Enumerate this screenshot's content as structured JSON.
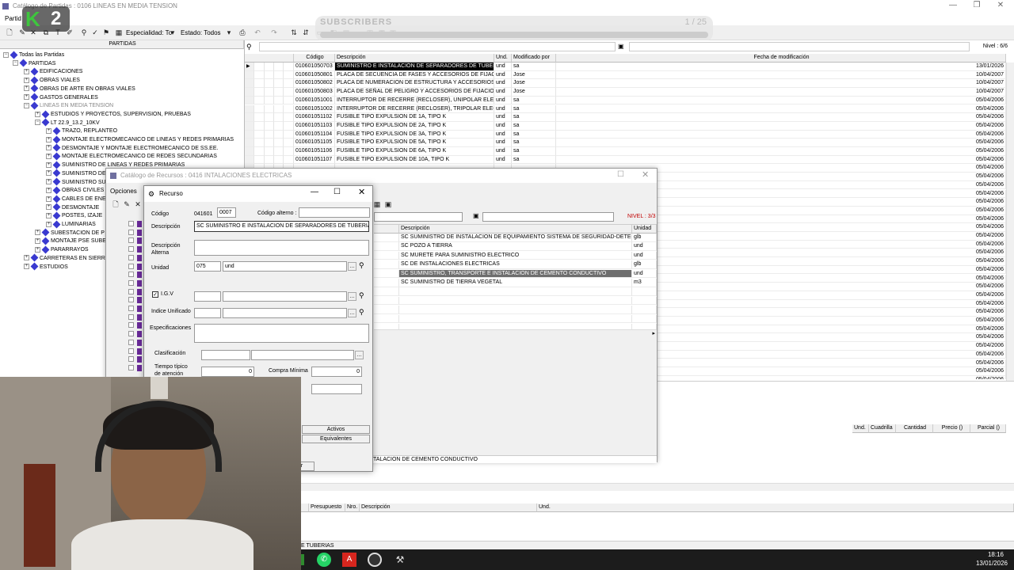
{
  "main_window": {
    "title": "Catálogo de Partidas : 0106  LINEAS EN MEDIA TENSION",
    "menu_partida": "Partid",
    "especialidad_label": "Especialidad: To",
    "estado_label": "Estado: Todos",
    "left_header": "PARTIDAS",
    "nivel": "Nivel : 6/6"
  },
  "overlay": {
    "channel_badge": "2",
    "subscribers_label": "SUBSCRIBERS",
    "counter": "1 / 25"
  },
  "grid": {
    "headers": [
      "Código",
      "Descripción",
      "Und.",
      "Modificado por",
      "Fecha de modificación"
    ],
    "rows": [
      [
        "010601050703",
        "SUMINISTRO E INSTALACIÓN DE SEPARADORES DE TUBERI",
        "und",
        "sa",
        "13/01/2026"
      ],
      [
        "010601050801",
        "PLACA DE SECUENCIA DE FASES Y ACCESORIOS DE FIJACIO",
        "und",
        "Jose",
        "10/04/2007"
      ],
      [
        "010601050802",
        "PLACA DE NUMERACION DE ESTRUCTURA Y ACCESORIOS D",
        "und",
        "Jose",
        "10/04/2007"
      ],
      [
        "010601050803",
        "PLACA DE SEÑAL DE PELIGRO Y ACCESORIOS DE FIJACION",
        "und",
        "Jose",
        "10/04/2007"
      ],
      [
        "010601051001",
        "INTERRUPTOR DE RECERRE (RECLOSER), UNIPOLAR ELECTR",
        "und",
        "sa",
        "05/04/2006"
      ],
      [
        "010601051002",
        "INTERRUPTOR DE RECERRE (RECLOSER), TRIPOLAR ELECTR",
        "und",
        "sa",
        "05/04/2006"
      ],
      [
        "010601051102",
        "FUSIBLE TIPO EXPULSION DE 1A, TIPO K",
        "und",
        "sa",
        "05/04/2006"
      ],
      [
        "010601051103",
        "FUSIBLE TIPO EXPULSION DE 2A, TIPO K",
        "und",
        "sa",
        "05/04/2006"
      ],
      [
        "010601051104",
        "FUSIBLE TIPO EXPULSION DE 3A, TIPO K",
        "und",
        "sa",
        "05/04/2006"
      ],
      [
        "010601051105",
        "FUSIBLE TIPO EXPULSION DE 5A, TIPO K",
        "und",
        "sa",
        "05/04/2006"
      ],
      [
        "010601051106",
        "FUSIBLE TIPO EXPULSION DE 6A, TIPO K",
        "und",
        "sa",
        "05/04/2006"
      ],
      [
        "010601051107",
        "FUSIBLE TIPO EXPULSION DE 10A, TIPO K",
        "und",
        "sa",
        "05/04/2006"
      ]
    ],
    "extra_dates": [
      "05/04/2006",
      "05/04/2006",
      "05/04/2006",
      "05/04/2006",
      "05/04/2006",
      "05/04/2006",
      "05/04/2006",
      "05/04/2006",
      "05/04/2006",
      "05/04/2006",
      "05/04/2006",
      "05/04/2006",
      "05/04/2006",
      "05/04/2006",
      "05/04/2006",
      "05/04/2006",
      "05/04/2006",
      "05/04/2006",
      "05/04/2006",
      "05/04/2006",
      "05/04/2006",
      "05/04/2006",
      "05/04/2006",
      "05/04/2006",
      "05/04/2006",
      "05/04/2006"
    ]
  },
  "tree": {
    "items": [
      {
        "label": "Todas las Partidas",
        "level": 0
      },
      {
        "label": "PARTIDAS",
        "level": 1
      },
      {
        "label": "EDIFICACIONES",
        "level": 2
      },
      {
        "label": "OBRAS VIALES",
        "level": 2
      },
      {
        "label": "OBRAS DE ARTE EN OBRAS VIALES",
        "level": 2
      },
      {
        "label": "GASTOS GENERALES",
        "level": 2
      },
      {
        "label": "LINEAS EN MEDIA TENSION",
        "level": 2
      },
      {
        "label": "ESTUDIOS Y PROYECTOS, SUPERVISION, PRUEBAS",
        "level": 3
      },
      {
        "label": "LT 22.9_13.2_10KV",
        "level": 3
      },
      {
        "label": "TRAZO, REPLANTEO",
        "level": 4
      },
      {
        "label": "MONTAJE ELECTROMECANICO DE LINEAS Y REDES PRIMARIAS",
        "level": 4
      },
      {
        "label": "DESMONTAJE Y MONTAJE ELECTROMECANICO DE SS.EE.",
        "level": 4
      },
      {
        "label": "MONTAJE ELECTROMECANICO DE REDES SECUNDARIAS",
        "level": 4
      },
      {
        "label": "SUMINISTRO DE LINEAS Y REDES PRIMARIAS",
        "level": 4
      },
      {
        "label": "SUMINISTRO DE",
        "level": 4
      },
      {
        "label": "SUMINISTRO SU",
        "level": 4
      },
      {
        "label": "OBRAS CIVILES",
        "level": 4
      },
      {
        "label": "CABLES DE ENE",
        "level": 4
      },
      {
        "label": "DESMONTAJE",
        "level": 4
      },
      {
        "label": "POSTES, IZAJE",
        "level": 4
      },
      {
        "label": "LUMINARIAS",
        "level": 4
      },
      {
        "label": "SUBESTACION DE P",
        "level": 3
      },
      {
        "label": "MONTAJE PSE SUBE",
        "level": 3
      },
      {
        "label": "PARARRAYOS",
        "level": 3
      },
      {
        "label": "CARRETERAS EN SIERR",
        "level": 2
      },
      {
        "label": "ESTUDIOS",
        "level": 2
      }
    ]
  },
  "recursos_window": {
    "title": "Catálogo de Recursos : 0416  INTALACIONES ELECTRICAS",
    "menu_opciones": "Opciones",
    "nivel": "NIVEL : 3/3",
    "headers": [
      "Descripción",
      "Unidad"
    ],
    "rows": [
      [
        "SC SUMINISTRO DE INSTALACION DE EQUIPAMIENTO SISTEMA DE SEGURIDAD-DETECCION",
        "glb"
      ],
      [
        "SC POZO A TIERRA",
        "und"
      ],
      [
        "SC MURETE PARA SUMINISTRO ELECTRICO",
        "und"
      ],
      [
        "SC DE INSTALACIONES ELECTRICAS",
        "glb"
      ],
      [
        "SC SUMINISTRO, TRANSPORTE E INSTALACION DE CEMENTO CONDUCTIVO",
        "und"
      ],
      [
        "SC SUMINISTRO DE TIERRA VEGETAL",
        "m3"
      ]
    ],
    "status_text": "TALACION DE CEMENTO CONDUCTIVO"
  },
  "recurso_dialog": {
    "title": "Recurso",
    "codigo_label": "Código",
    "codigo_prefix": "041601",
    "codigo_value": "0007",
    "codigo_alterno_label": "Código alterno :",
    "descripcion_label": "Descripción",
    "descripcion_value": "SC SUMINISTRO E INSTALACION DE SEPARADORES DE TUBERIAS",
    "desc_alterna_label_1": "Descripción",
    "desc_alterna_label_2": "Alterna",
    "unidad_label": "Unidad",
    "unidad_code": "075",
    "unidad_value": "und",
    "igv_label": "I.G.V",
    "indice_label": "Indice Unificado",
    "especificaciones_label": "Especificaciones",
    "clasificacion_label": "Clasificación",
    "tiempo_label_1": "Tiempo típico",
    "tiempo_label_2": "de atención",
    "tiempo_value": "0",
    "compra_label": "Compra Mínima",
    "compra_value": "0",
    "activos_button": "Activos",
    "equivalentes_button": "Equivalentes",
    "cut_label": "ar"
  },
  "bottom_panel": {
    "headers_right": [
      "Und.",
      "Cuadrilla",
      "Cantidad",
      "Precio ()",
      "Parcial ()"
    ],
    "headers_bottom": [
      "Presupuesto",
      "Nro.",
      "Descripción",
      "Und."
    ],
    "status_text": "E TUBERIAS"
  },
  "taskbar": {
    "time": "18:16",
    "date": "13/01/2026"
  }
}
